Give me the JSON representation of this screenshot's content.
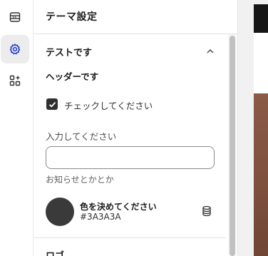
{
  "rail": {
    "items": [
      {
        "icon": "sections-icon",
        "active": false
      },
      {
        "icon": "gear-icon",
        "active": true
      },
      {
        "icon": "apps-add-icon",
        "active": false
      }
    ]
  },
  "panel": {
    "title": "テーマ設定",
    "section": {
      "title": "テストです",
      "header": "ヘッダーです",
      "checkbox": {
        "label": "チェックしてください",
        "checked": true
      },
      "input": {
        "label": "入力してください",
        "value": "",
        "help": "お知らせとかとか"
      },
      "color": {
        "label": "色を決めてください",
        "value": "#3A3A3A"
      }
    },
    "section2": {
      "title": "ロゴ"
    }
  },
  "colors": {
    "accent": "#303030",
    "swatch": "#3A3A3A",
    "active_rail_bg": "#ececec"
  }
}
